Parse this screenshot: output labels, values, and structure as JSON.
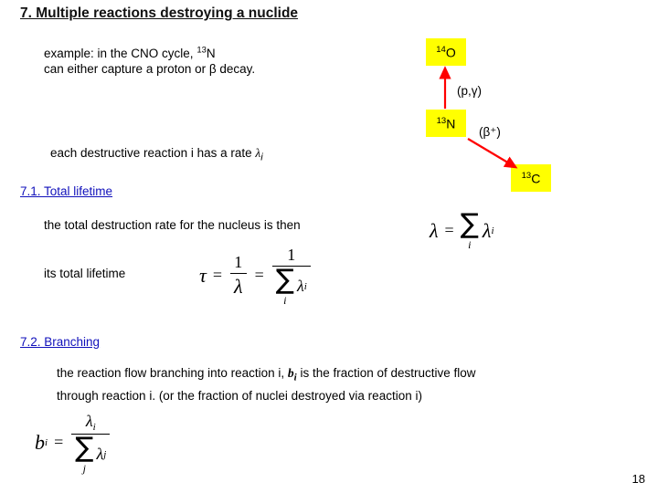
{
  "slide": {
    "title": "7. Multiple reactions destroying a nuclide",
    "page_number": "18",
    "example_line1_pre": "example: in the CNO cycle, ",
    "example_line1_mass": "13",
    "example_line1_sym": "N",
    "example_line2": "can either capture a proton or β decay.",
    "rate_line_pre": "each destructive reaction i has a rate ",
    "rate_line_lambda": "λ",
    "rate_line_sub": "i",
    "section_71": "7.1. Total lifetime",
    "total_destruction_text": "the total destruction rate for the nucleus is then",
    "its_total_lifetime_text": "its total lifetime",
    "section_72": "7.2. Branching",
    "branching_text_line1_a": "the reaction flow branching into reaction i, ",
    "branching_text_line1_b": "b",
    "branching_text_line1_c": "i",
    "branching_text_line1_d": " is the fraction of destructive flow",
    "branching_text_line2": "through reaction i. (or the fraction of nuclei destroyed via reaction i)"
  },
  "diagram": {
    "nuclides": [
      {
        "name": "o14",
        "mass": "14",
        "symbol": "O"
      },
      {
        "name": "n13",
        "mass": "13",
        "symbol": "N"
      },
      {
        "name": "c13",
        "mass": "13",
        "symbol": "C"
      }
    ],
    "labels": [
      {
        "name": "proton-gamma",
        "text": "(p,γ)"
      },
      {
        "name": "beta-plus",
        "text": "(β⁺)"
      }
    ],
    "arrow_color": "#ff0000",
    "box_color": "#ffff00"
  },
  "equations": {
    "lambda_total": {
      "lhs": "λ",
      "eq": "=",
      "sum": "∑",
      "index": "i",
      "term": "λ",
      "term_sub": "i"
    },
    "tau_total": {
      "lhs": "τ",
      "eq1": "=",
      "num1": "1",
      "den1": "λ",
      "eq2": "=",
      "num2": "1",
      "sum": "∑",
      "index": "i",
      "term": "λ",
      "term_sub": "i"
    },
    "branching": {
      "lhs": "b",
      "lhs_sub": "i",
      "eq": "=",
      "num": "λ",
      "num_sub": "i",
      "sum": "∑",
      "index": "j",
      "den": "λ",
      "den_sub": "j"
    }
  },
  "colors": {
    "section_link": "#1111bb",
    "highlight": "#ffff00",
    "arrow": "#ff0000"
  }
}
